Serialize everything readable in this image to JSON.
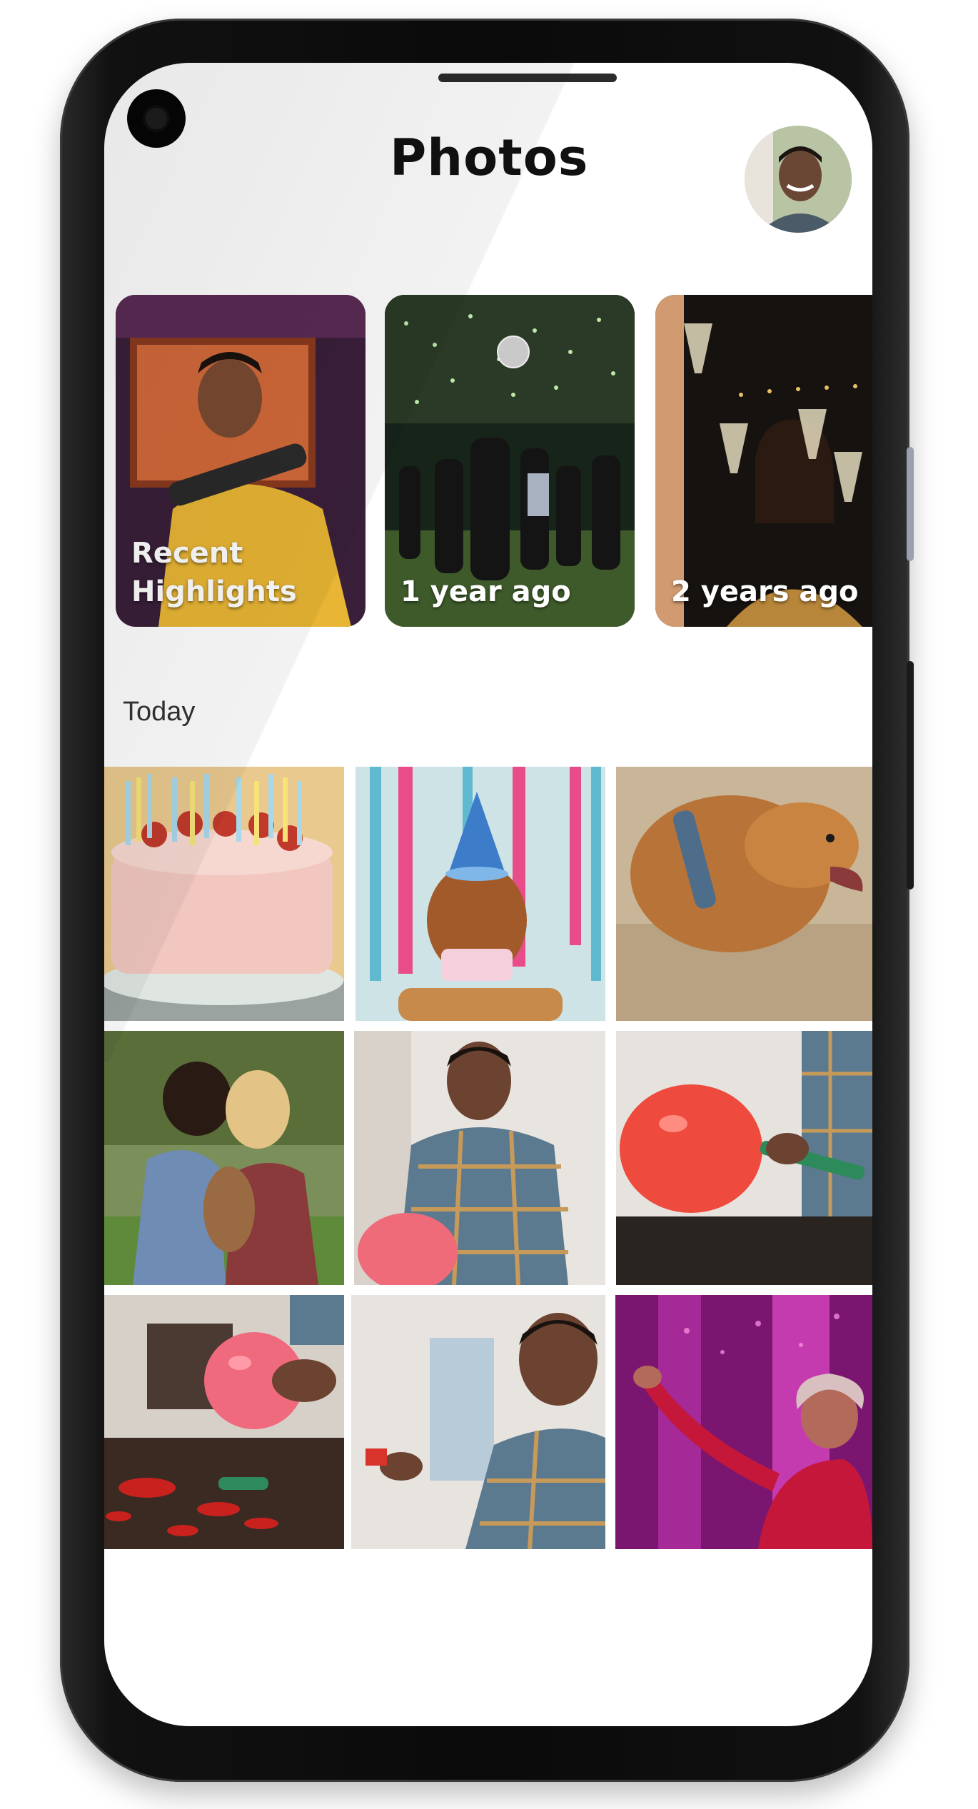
{
  "app": {
    "title": "Photos"
  },
  "highlights": [
    {
      "label": "Recent Highlights",
      "art": "musician-icon"
    },
    {
      "label": "1 year ago",
      "art": "street-party-icon"
    },
    {
      "label": "2 years ago",
      "art": "champagne-toast-icon"
    }
  ],
  "section": {
    "title": "Today"
  },
  "photos": [
    {
      "art": "birthday-cake-icon"
    },
    {
      "art": "party-hat-dog-icon"
    },
    {
      "art": "golden-retriever-icon"
    },
    {
      "art": "couple-with-dog-icon"
    },
    {
      "art": "man-with-balloon-icon"
    },
    {
      "art": "inflating-balloon-icon"
    },
    {
      "art": "pink-balloon-table-icon"
    },
    {
      "art": "man-smiling-icon"
    },
    {
      "art": "disco-dancer-icon"
    }
  ],
  "colors": {
    "accent": "#111111",
    "background": "#ffffff"
  }
}
